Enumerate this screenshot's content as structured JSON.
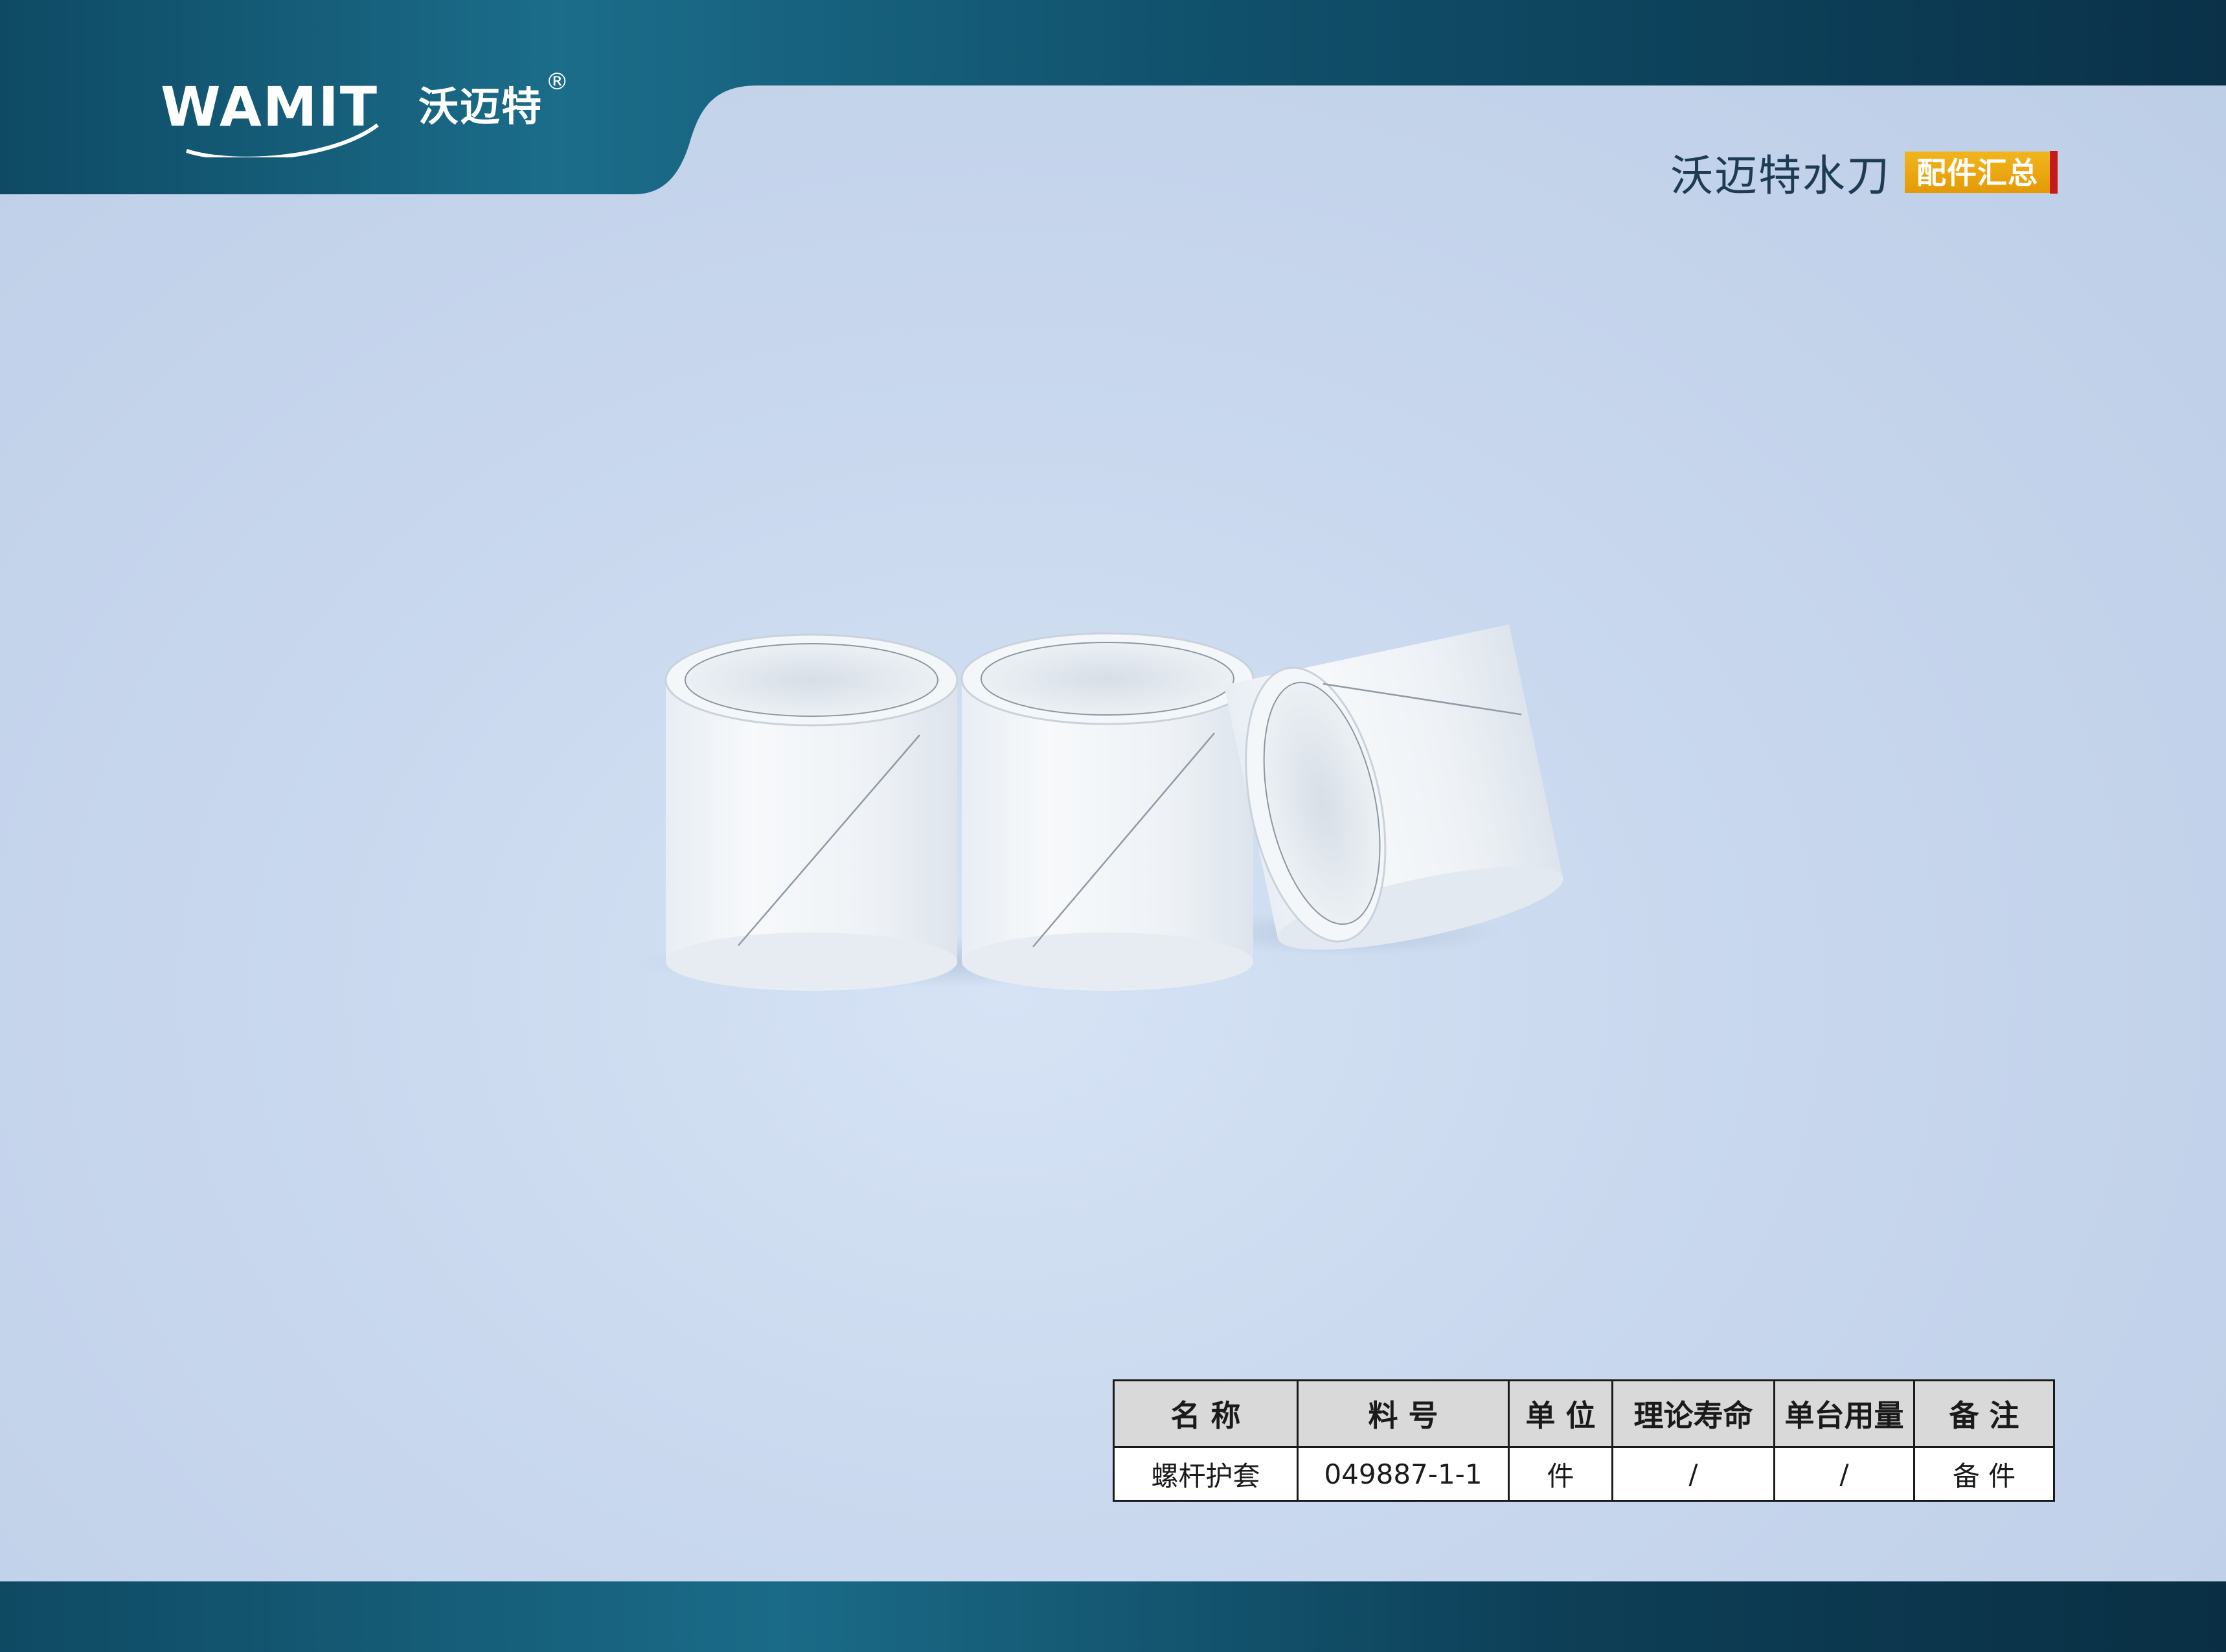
{
  "header": {
    "logo_text": "WAMIT",
    "logo_cn": "沃迈特",
    "logo_reg": "®",
    "title": "沃迈特水刀",
    "badge": "配件汇总"
  },
  "colors": {
    "header_band": "#0f4a63",
    "background": "#c9d8ee",
    "badge": "#e9a60d",
    "accent_bar": "#c41a1a",
    "table_header_bg": "#d9d9d9"
  },
  "table": {
    "columns": [
      "名 称",
      "料 号",
      "单 位",
      "理论寿命",
      "单台用量",
      "备 注"
    ],
    "rows": [
      [
        "螺杆护套",
        "049887-1-1",
        "件",
        "/",
        "/",
        "备 件"
      ]
    ]
  }
}
